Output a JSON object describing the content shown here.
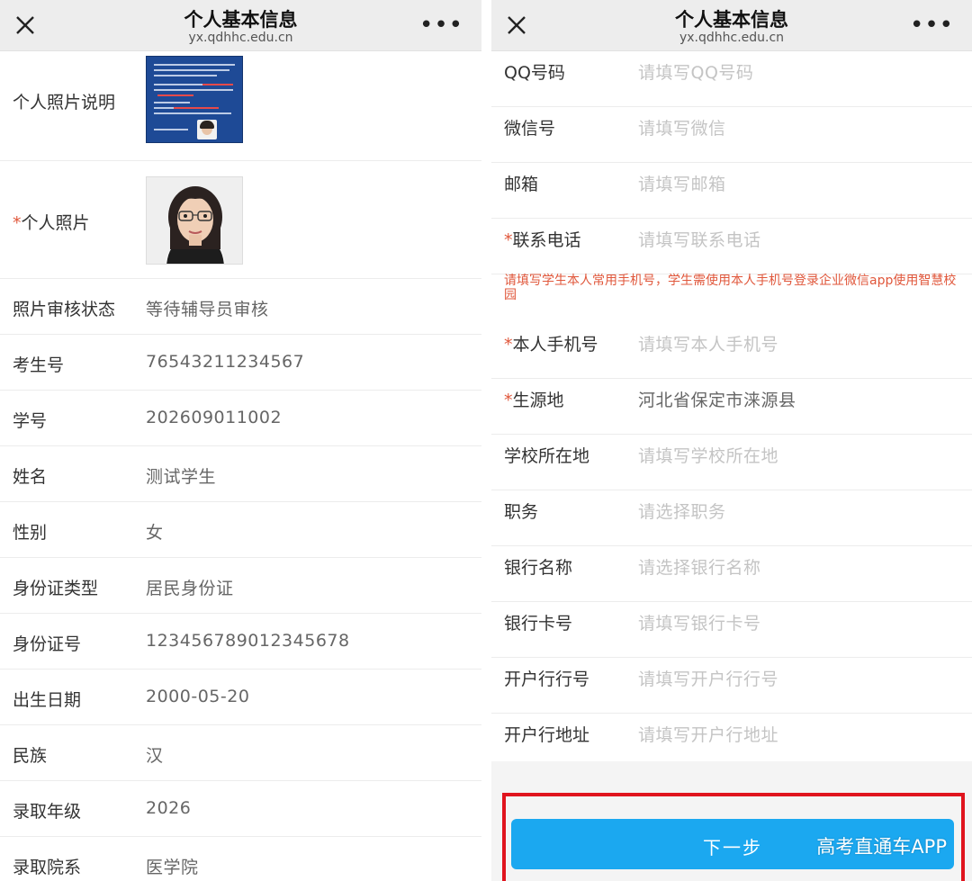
{
  "left": {
    "nav": {
      "title": "个人基本信息",
      "url": "yx.qdhhc.edu.cn",
      "close_icon": "close-icon",
      "more_icon": "more-icon"
    },
    "photo_note": {
      "label": "个人照片说明"
    },
    "photo": {
      "required_mark": "*",
      "label": "个人照片"
    },
    "fields": [
      {
        "label": "照片审核状态",
        "value": "等待辅导员审核"
      },
      {
        "label": "考生号",
        "value": "76543211234567"
      },
      {
        "label": "学号",
        "value": "202609011002"
      },
      {
        "label": "姓名",
        "value": "测试学生"
      },
      {
        "label": "性别",
        "value": "女"
      },
      {
        "label": "身份证类型",
        "value": "居民身份证"
      },
      {
        "label": "身份证号",
        "value": "123456789012345678"
      },
      {
        "label": "出生日期",
        "value": "2000-05-20"
      },
      {
        "label": "民族",
        "value": "汉"
      },
      {
        "label": "录取年级",
        "value": "2026"
      },
      {
        "label": "录取院系",
        "value": "医学院"
      }
    ]
  },
  "right": {
    "nav": {
      "title": "个人基本信息",
      "url": "yx.qdhhc.edu.cn",
      "close_icon": "close-icon",
      "more_icon": "more-icon"
    },
    "fields": [
      {
        "required": false,
        "label": "QQ号码",
        "placeholder": "请填写QQ号码"
      },
      {
        "required": false,
        "label": "微信号",
        "placeholder": "请填写微信"
      },
      {
        "required": false,
        "label": "邮箱",
        "placeholder": "请填写邮箱"
      },
      {
        "required": true,
        "label": "联系电话",
        "placeholder": "请填写联系电话"
      }
    ],
    "hint": "请填写学生本人常用手机号，学生需使用本人手机号登录企业微信app使用智慧校园",
    "fields2": [
      {
        "required": true,
        "label": "本人手机号",
        "placeholder": "请填写本人手机号"
      },
      {
        "required": true,
        "label": "生源地",
        "value": "河北省保定市涞源县"
      },
      {
        "required": false,
        "label": "学校所在地",
        "placeholder": "请填写学校所在地"
      },
      {
        "required": false,
        "label": "职务",
        "placeholder": "请选择职务"
      },
      {
        "required": false,
        "label": "银行名称",
        "placeholder": "请选择银行名称"
      },
      {
        "required": false,
        "label": "银行卡号",
        "placeholder": "请填写银行卡号"
      },
      {
        "required": false,
        "label": "开户行行号",
        "placeholder": "请填写开户行行号"
      },
      {
        "required": false,
        "label": "开户行地址",
        "placeholder": "请填写开户行地址"
      }
    ],
    "required_mark": "*",
    "next_button": "下一步",
    "watermark": "高考直通车APP",
    "colors": {
      "button": "#1ba8f0",
      "highlight_frame": "#e0141e",
      "required": "#e0573b"
    }
  }
}
